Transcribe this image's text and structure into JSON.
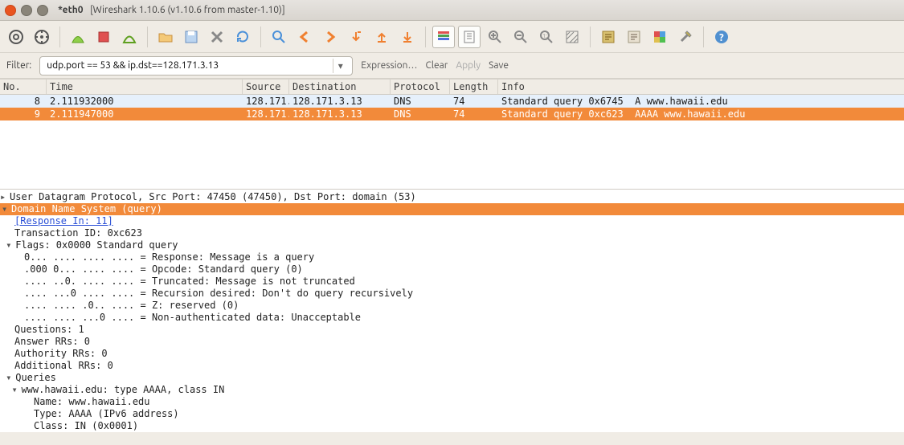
{
  "title": {
    "iface": "*eth0",
    "app": "[Wireshark 1.10.6  (v1.10.6 from master-1.10)]"
  },
  "filter": {
    "label": "Filter:",
    "value": "udp.port == 53 && ip.dst==128.171.3.13",
    "expression": "Expression…",
    "clear": "Clear",
    "apply": "Apply",
    "save": "Save"
  },
  "columns": {
    "no": "No.",
    "time": "Time",
    "src": "Source",
    "dst": "Destination",
    "proto": "Protocol",
    "len": "Length",
    "info": "Info"
  },
  "rows": [
    {
      "no": "8",
      "time": "2.111932000",
      "src": "128.171.",
      "dst": "128.171.3.13",
      "proto": "DNS",
      "len": "74",
      "info": "Standard query 0x6745  A www.hawaii.edu",
      "style": "sel"
    },
    {
      "no": "9",
      "time": "2.111947000",
      "src": "128.171.",
      "dst": "128.171.3.13",
      "proto": "DNS",
      "len": "74",
      "info": "Standard query 0xc623  AAAA www.hawaii.edu",
      "style": "hl"
    }
  ],
  "details": {
    "udp": "User Datagram Protocol, Src Port: 47450 (47450), Dst Port: domain (53)",
    "dns_header": "Domain Name System (query)",
    "response_in": "[Response In: 11]",
    "txid": "Transaction ID: 0xc623",
    "flags_line": "Flags: 0x0000 Standard query",
    "flag_lines": [
      "0... .... .... .... = Response: Message is a query",
      ".000 0... .... .... = Opcode: Standard query (0)",
      ".... ..0. .... .... = Truncated: Message is not truncated",
      ".... ...0 .... .... = Recursion desired: Don't do query recursively",
      ".... .... .0.. .... = Z: reserved (0)",
      ".... .... ...0 .... = Non-authenticated data: Unacceptable"
    ],
    "questions": "Questions: 1",
    "answer": "Answer RRs: 0",
    "authority": "Authority RRs: 0",
    "additional": "Additional RRs: 0",
    "queries": "Queries",
    "query_line": "www.hawaii.edu: type AAAA, class IN",
    "q_name": "Name: www.hawaii.edu",
    "q_type": "Type: AAAA (IPv6 address)",
    "q_class": "Class: IN (0x0001)"
  }
}
